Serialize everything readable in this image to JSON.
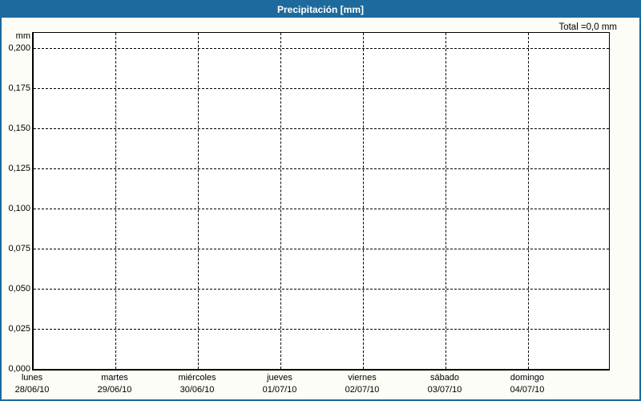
{
  "window": {
    "title": "Precipitación [mm]"
  },
  "total_label": "Total =0,0 mm",
  "colors": {
    "title_bar": "#1e6a9c",
    "frame_border": "#1e6a9c",
    "background": "#fcfdf6",
    "plot_background": "#ffffff",
    "grid": "#000000",
    "title_text": "#ffffff",
    "text": "#000000"
  },
  "y_axis": {
    "unit": "mm",
    "ticks": [
      "0,200",
      "0,175",
      "0,150",
      "0,125",
      "0,100",
      "0,075",
      "0,050",
      "0,025",
      "0,000"
    ]
  },
  "x_axis": {
    "days": [
      {
        "name": "lunes",
        "date": "28/06/10"
      },
      {
        "name": "martes",
        "date": "29/06/10"
      },
      {
        "name": "miércoles",
        "date": "30/06/10"
      },
      {
        "name": "jueves",
        "date": "01/07/10"
      },
      {
        "name": "viernes",
        "date": "02/07/10"
      },
      {
        "name": "sábado",
        "date": "03/07/10"
      },
      {
        "name": "domingo",
        "date": "04/07/10"
      }
    ]
  },
  "chart_data": {
    "type": "bar",
    "title": "Precipitación [mm]",
    "ylabel": "mm",
    "xlabel": "",
    "categories": [
      "28/06/10",
      "29/06/10",
      "30/06/10",
      "01/07/10",
      "02/07/10",
      "03/07/10",
      "04/07/10"
    ],
    "category_day_names": [
      "lunes",
      "martes",
      "miércoles",
      "jueves",
      "viernes",
      "sábado",
      "domingo"
    ],
    "values": [
      0,
      0,
      0,
      0,
      0,
      0,
      0
    ],
    "ylim": [
      0,
      0.21
    ],
    "y_tick_step": 0.025,
    "grid": "dashed",
    "legend_position": "none",
    "total": "0,0 mm"
  }
}
